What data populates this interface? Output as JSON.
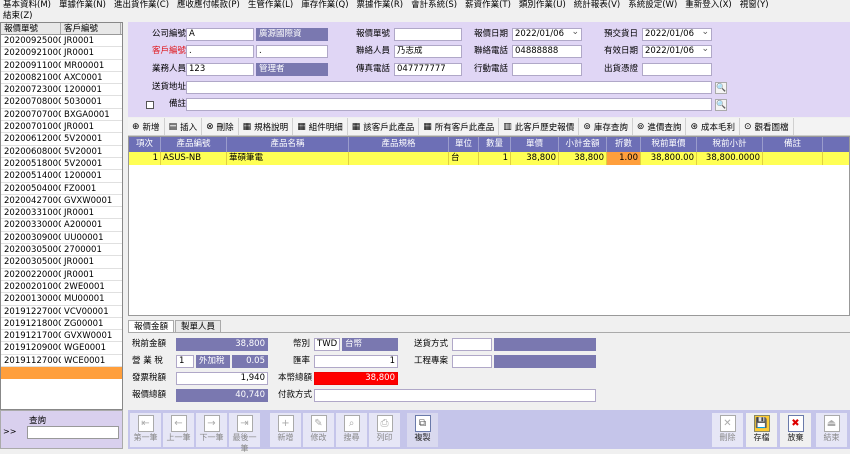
{
  "menu": [
    "基本資料(M)",
    "單據作業(N)",
    "進出貨作業(C)",
    "應收應付帳款(P)",
    "生管作業(L)",
    "庫存作業(Q)",
    "票據作業(R)",
    "會計系統(S)",
    "薪資作業(T)",
    "類別作業(U)",
    "統計報表(V)",
    "系統設定(W)",
    "重新登入(X)",
    "視窗(Y)"
  ],
  "menu2": "結束(Z)",
  "left_list": {
    "headers": [
      "報價單號",
      "客戶編號"
    ],
    "rows": [
      [
        "20200925000",
        "JR0001"
      ],
      [
        "20200921000",
        "JR0001"
      ],
      [
        "20200911000",
        "MR00001"
      ],
      [
        "20200821000",
        "AXC0001"
      ],
      [
        "20200723000",
        "1200001"
      ],
      [
        "20200708000",
        "5030001"
      ],
      [
        "20200707000",
        "BXGA0001"
      ],
      [
        "20200701000",
        "JR0001"
      ],
      [
        "20200612000",
        "5V20001"
      ],
      [
        "20200608000",
        "5V20001"
      ],
      [
        "20200518000",
        "5V20001"
      ],
      [
        "20200514000",
        "1200001"
      ],
      [
        "20200504000",
        "FZ0001"
      ],
      [
        "20200427000",
        "GVXW0001"
      ],
      [
        "20200331000",
        "JR0001"
      ],
      [
        "20200330000",
        "A200001"
      ],
      [
        "20200309000",
        "UU00001"
      ],
      [
        "20200305000",
        "2700001"
      ],
      [
        "20200305000",
        "JR0001"
      ],
      [
        "20200220000",
        "JR0001"
      ],
      [
        "20200201000",
        "2WE0001"
      ],
      [
        "20200130000",
        "MU00001"
      ],
      [
        "20191227000",
        "VCV00001"
      ],
      [
        "20191218000",
        "ZG00001"
      ],
      [
        "20191217000",
        "GVXW0001"
      ],
      [
        "20191209000",
        "WGE0001"
      ],
      [
        "20191127000",
        "WCE0001"
      ]
    ]
  },
  "query_label": "查詢",
  "query_arrow": ">>",
  "form": {
    "company_code_label": "公司編號",
    "company_code": "A",
    "company_name": "廣源國際資",
    "customer_code_label": "客戶編號",
    "customer_code": ".",
    "customer_name": ".",
    "sales_label": "業務人員",
    "sales_code": "123",
    "sales_name": "管理者",
    "address_label": "送貨地址",
    "address": "",
    "note_label": "備註",
    "note": "",
    "quote_no_label": "報價單號",
    "quote_no": "",
    "contact_label": "聯絡人員",
    "contact": "乃志成",
    "fax_label": "傳真電話",
    "fax": "047777777",
    "quote_date_label": "報價日期",
    "quote_date": "2022/01/06",
    "phone_label": "聯絡電話",
    "phone": "04888888",
    "mobile_label": "行動電話",
    "mobile": "",
    "delivery_date_label": "預交貨日",
    "delivery_date": "2022/01/06",
    "valid_date_label": "有效日期",
    "valid_date": "2022/01/06",
    "ship_cert_label": "出貨憑證",
    "ship_cert": ""
  },
  "toolbar": [
    "新增",
    "插入",
    "刪除",
    "規格說明",
    "組件明細",
    "該客戶此產品",
    "所有客戶此產品",
    "此客戶歷史報價",
    "庫存查詢",
    "進價查詢",
    "成本毛利",
    "觀看圖檔"
  ],
  "grid": {
    "headers": [
      "項次",
      "產品編號",
      "產品名稱",
      "產品規格",
      "單位",
      "數量",
      "單價",
      "小計金額",
      "折數",
      "稅前單價",
      "稅前小計",
      "備註"
    ],
    "rows": [
      [
        "1",
        "ASUS-NB",
        "華碩筆電",
        "",
        "台",
        "1",
        "38,800",
        "38,800",
        "1.00",
        "38,800.00",
        "38,800.0000",
        ""
      ]
    ]
  },
  "tabs": [
    "報價金額",
    "製單人員"
  ],
  "totals": {
    "pretax_label": "稅前金額",
    "pretax": "38,800",
    "tax_label": "營 業 稅",
    "tax_rate": "1",
    "tax_type": "外加稅",
    "tax_value": "0.05",
    "invoice_tax_label": "發票稅額",
    "invoice_tax": "1,940",
    "total_label": "報價總額",
    "total": "40,740",
    "currency_label": "幣別",
    "currency": "TWD",
    "currency_name": "台幣",
    "rate_label": "匯率",
    "rate": "1",
    "local_total_label": "本幣總額",
    "local_total": "38,800",
    "pay_label": "付款方式",
    "pay": "",
    "ship_method_label": "送貨方式",
    "ship_method": "",
    "project_label": "工程專案",
    "project": ""
  },
  "nav": {
    "first": "第一筆",
    "prev": "上一筆",
    "next": "下一筆",
    "last": "最後一筆",
    "new": "新增",
    "edit": "修改",
    "search": "搜尋",
    "print": "列印",
    "copy": "複製",
    "delete": "刪除",
    "save": "存檔",
    "discard": "放棄",
    "exit": "結束"
  },
  "colors": {
    "form_bg": "#e0d6f5",
    "grid_header": "#6d6fb6",
    "selected_row": "#ffff55",
    "discount_cell": "#ff9f3c",
    "local_total_bg": "#ff0000"
  }
}
